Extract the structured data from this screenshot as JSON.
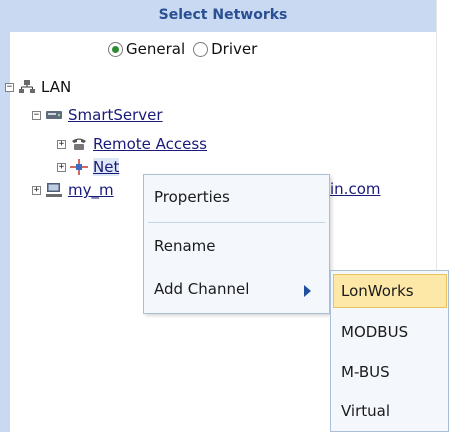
{
  "header": {
    "title": "Select Networks"
  },
  "mode": {
    "options": [
      {
        "label": "General",
        "selected": true
      },
      {
        "label": "Driver",
        "selected": false
      }
    ]
  },
  "tree": {
    "root": {
      "label": "LAN",
      "toggle": "−"
    },
    "server": {
      "label": "SmartServer",
      "toggle": "−"
    },
    "remote": {
      "label": "Remote Access",
      "toggle": "+"
    },
    "net": {
      "label": "Net",
      "toggle": "+"
    },
    "host": {
      "label_left": "my_m",
      "label_right": "in.com",
      "toggle": "+"
    }
  },
  "context_menu": {
    "properties": "Properties",
    "rename": "Rename",
    "add_channel": "Add Channel"
  },
  "submenu": {
    "items": [
      "LonWorks",
      "MODBUS",
      "M-BUS",
      "Virtual"
    ],
    "highlighted": "LonWorks",
    "highlight_color": "#fde8a8"
  },
  "colors": {
    "header_bg": "#c9d9f1",
    "header_text": "#2a4f92",
    "menu_bg": "#f4f7fb"
  }
}
